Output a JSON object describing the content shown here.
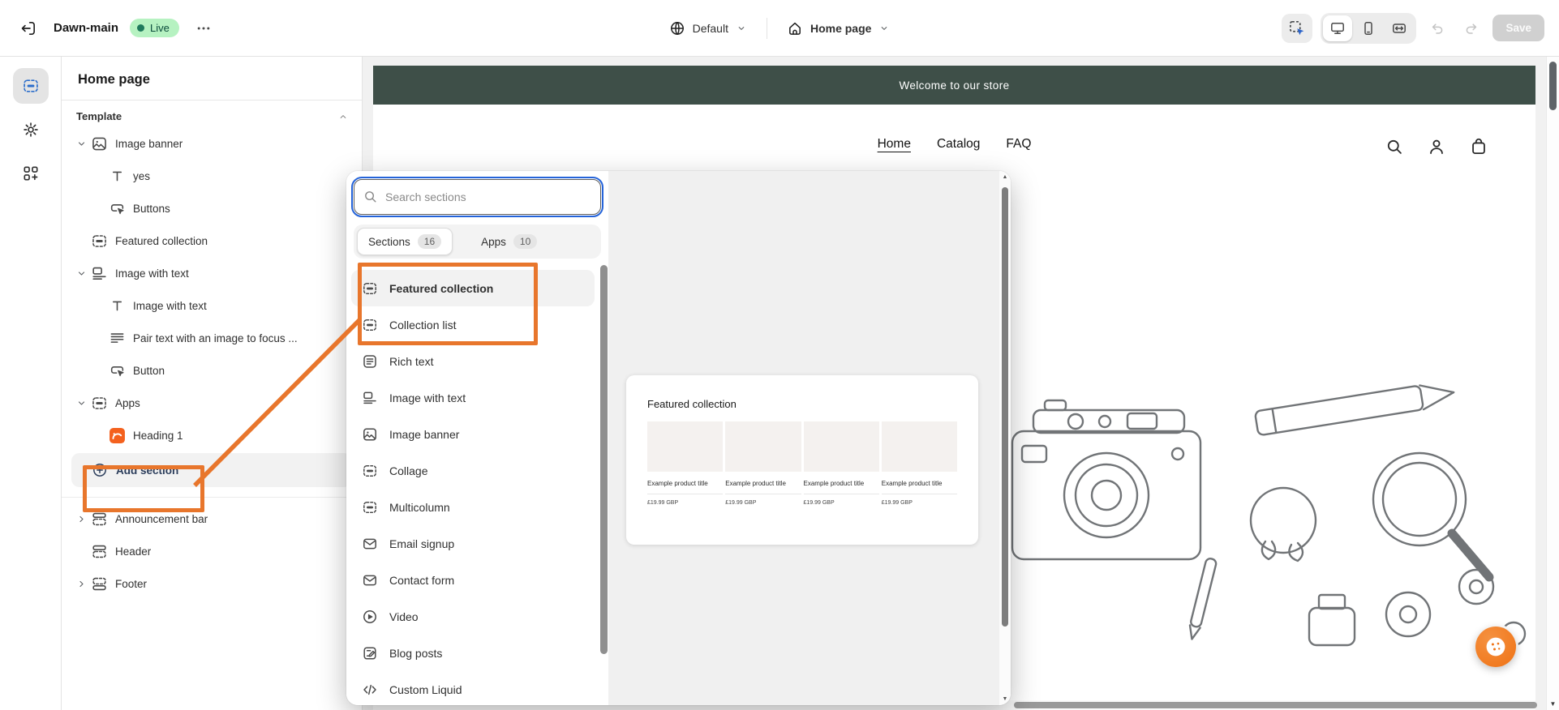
{
  "topbar": {
    "theme_name": "Dawn-main",
    "live_label": "Live",
    "locale_label": "Default",
    "page_label": "Home page",
    "save_label": "Save"
  },
  "rail": {
    "items": [
      {
        "icon": "sections-icon",
        "active": true
      },
      {
        "icon": "settings-gear-icon",
        "active": false
      },
      {
        "icon": "apps-icon",
        "active": false
      }
    ]
  },
  "sidebar": {
    "title": "Home page",
    "group_label": "Template",
    "tree": [
      {
        "label": "Image banner",
        "icon": "image-banner-icon",
        "level": 0,
        "chevron": "down"
      },
      {
        "label": "yes",
        "icon": "text-icon",
        "level": 1
      },
      {
        "label": "Buttons",
        "icon": "button-cursor-icon",
        "level": 1
      },
      {
        "label": "Featured collection",
        "icon": "section-icon",
        "level": 0
      },
      {
        "label": "Image with text",
        "icon": "image-with-text-icon",
        "level": 0,
        "chevron": "down"
      },
      {
        "label": "Image with text",
        "icon": "text-icon",
        "level": 1
      },
      {
        "label": "Pair text with an image to focus ...",
        "icon": "paragraph-icon",
        "level": 1
      },
      {
        "label": "Button",
        "icon": "button-cursor-icon",
        "level": 1
      },
      {
        "label": "Apps",
        "icon": "apps-section-icon",
        "level": 0,
        "chevron": "down"
      },
      {
        "label": "Heading 1",
        "icon": "app-block-icon",
        "level": 1
      }
    ],
    "add_section_label": "Add section",
    "fixed_tree": [
      {
        "label": "Announcement bar",
        "icon": "header-section-icon",
        "chevron": "right"
      },
      {
        "label": "Header",
        "icon": "header-section-icon",
        "chevron": ""
      },
      {
        "label": "Footer",
        "icon": "footer-section-icon",
        "chevron": "right"
      }
    ]
  },
  "popup": {
    "search_placeholder": "Search sections",
    "tabs": [
      {
        "label": "Sections",
        "count": "16",
        "active": true
      },
      {
        "label": "Apps",
        "count": "10",
        "active": false
      }
    ],
    "sections": [
      {
        "label": "Featured collection",
        "icon": "section-icon",
        "highlighted": true
      },
      {
        "label": "Collection list",
        "icon": "section-icon",
        "highlighted": false
      },
      {
        "label": "Rich text",
        "icon": "rich-text-icon",
        "highlighted": false
      },
      {
        "label": "Image with text",
        "icon": "image-with-text-icon",
        "highlighted": false
      },
      {
        "label": "Image banner",
        "icon": "image-banner-icon",
        "highlighted": false
      },
      {
        "label": "Collage",
        "icon": "section-icon",
        "highlighted": false
      },
      {
        "label": "Multicolumn",
        "icon": "section-icon",
        "highlighted": false
      },
      {
        "label": "Email signup",
        "icon": "email-icon",
        "highlighted": false
      },
      {
        "label": "Contact form",
        "icon": "email-icon",
        "highlighted": false
      },
      {
        "label": "Video",
        "icon": "video-icon",
        "highlighted": false
      },
      {
        "label": "Blog posts",
        "icon": "blog-icon",
        "highlighted": false
      },
      {
        "label": "Custom Liquid",
        "icon": "code-icon",
        "highlighted": false
      }
    ],
    "preview": {
      "title": "Featured collection",
      "products": [
        {
          "title": "Example product title",
          "price": "£19.99 GBP"
        },
        {
          "title": "Example product title",
          "price": "£19.99 GBP"
        },
        {
          "title": "Example product title",
          "price": "£19.99 GBP"
        },
        {
          "title": "Example product title",
          "price": "£19.99 GBP"
        }
      ]
    }
  },
  "storefront": {
    "announcement": "Welcome to our store",
    "nav": [
      {
        "label": "Home",
        "active": true
      },
      {
        "label": "Catalog",
        "active": false
      },
      {
        "label": "FAQ",
        "active": false
      }
    ]
  },
  "colors": {
    "annotation_orange": "#E8762C",
    "announcement_bg": "#3E4F48",
    "live_badge_bg": "#B6F2C1",
    "accent_blue": "#2C6ECB",
    "app_block_orange": "#F4611E"
  }
}
